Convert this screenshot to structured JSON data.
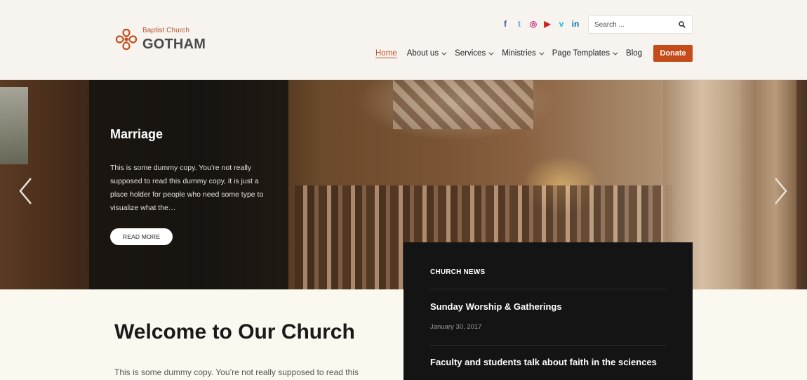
{
  "header": {
    "logo": {
      "subtitle": "Baptist Church",
      "title": "GOTHAM"
    },
    "social": [
      {
        "name": "facebook",
        "glyph": "f",
        "color": "#3b5998"
      },
      {
        "name": "twitter",
        "glyph": "t",
        "color": "#55acee"
      },
      {
        "name": "instagram",
        "glyph": "◎",
        "color": "#c13584"
      },
      {
        "name": "youtube",
        "glyph": "▶",
        "color": "#cd201f"
      },
      {
        "name": "vimeo",
        "glyph": "v",
        "color": "#1ab7ea"
      },
      {
        "name": "linkedin",
        "glyph": "in",
        "color": "#0077b5"
      }
    ],
    "search": {
      "placeholder": "Search ..."
    },
    "nav": [
      {
        "label": "Home",
        "active": true,
        "dropdown": false
      },
      {
        "label": "About us",
        "active": false,
        "dropdown": true
      },
      {
        "label": "Services",
        "active": false,
        "dropdown": true
      },
      {
        "label": "Ministries",
        "active": false,
        "dropdown": true
      },
      {
        "label": "Page Templates",
        "active": false,
        "dropdown": true
      },
      {
        "label": "Blog",
        "active": false,
        "dropdown": false
      }
    ],
    "donate_label": "Donate",
    "accent": "#c54b18"
  },
  "hero": {
    "title": "Marriage",
    "text": "This is some dummy copy. You’re not really supposed to read this dummy copy, it is just a place holder for people who need some type to visualize what the…",
    "button": "READ MORE"
  },
  "news": {
    "heading": "CHURCH NEWS",
    "items": [
      {
        "title": "Sunday Worship & Gatherings",
        "date": "January 30, 2017"
      },
      {
        "title": "Faculty and students talk about faith in the sciences",
        "date": ""
      }
    ]
  },
  "welcome": {
    "title": "Welcome to Our Church",
    "text": "This is some dummy copy. You’re not really supposed to read this"
  }
}
